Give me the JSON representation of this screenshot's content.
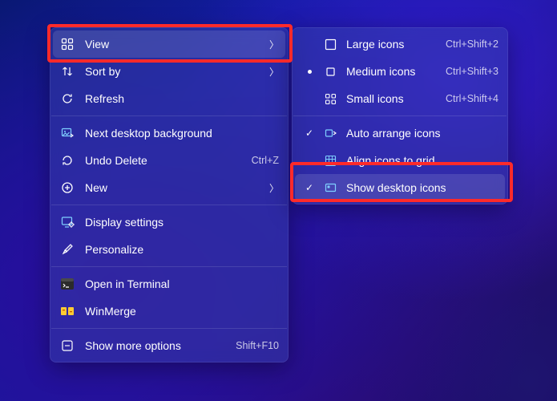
{
  "context_menu": {
    "groups": [
      [
        {
          "id": "view",
          "label": "View",
          "icon": "grid-icon",
          "shortcut": "",
          "submenu": true,
          "hover": true
        },
        {
          "id": "sortby",
          "label": "Sort by",
          "icon": "sort-icon",
          "shortcut": "",
          "submenu": true
        },
        {
          "id": "refresh",
          "label": "Refresh",
          "icon": "refresh-icon",
          "shortcut": ""
        }
      ],
      [
        {
          "id": "next-bg",
          "label": "Next desktop background",
          "icon": "picture-next-icon",
          "shortcut": ""
        },
        {
          "id": "undo",
          "label": "Undo Delete",
          "icon": "undo-icon",
          "shortcut": "Ctrl+Z"
        },
        {
          "id": "new",
          "label": "New",
          "icon": "plus-circle-icon",
          "shortcut": "",
          "submenu": true
        }
      ],
      [
        {
          "id": "display",
          "label": "Display settings",
          "icon": "display-gear-icon"
        },
        {
          "id": "perso",
          "label": "Personalize",
          "icon": "brush-icon"
        }
      ],
      [
        {
          "id": "terminal",
          "label": "Open in Terminal",
          "icon": "terminal-icon"
        },
        {
          "id": "winmerge",
          "label": "WinMerge",
          "icon": "winmerge-icon"
        }
      ],
      [
        {
          "id": "more",
          "label": "Show more options",
          "icon": "more-options-icon",
          "shortcut": "Shift+F10"
        }
      ]
    ]
  },
  "view_submenu": {
    "groups": [
      [
        {
          "id": "large",
          "label": "Large icons",
          "icon": "large-square-icon",
          "shortcut": "Ctrl+Shift+2",
          "radio": false
        },
        {
          "id": "medium",
          "label": "Medium icons",
          "icon": "medium-square-icon",
          "shortcut": "Ctrl+Shift+3",
          "radio": true
        },
        {
          "id": "small",
          "label": "Small icons",
          "icon": "small-grid-icon",
          "shortcut": "Ctrl+Shift+4",
          "radio": false
        }
      ],
      [
        {
          "id": "autoarrange",
          "label": "Auto arrange icons",
          "icon": "auto-arrange-icon",
          "checked": true
        },
        {
          "id": "align",
          "label": "Align icons to grid",
          "icon": "align-grid-icon",
          "checked": false
        },
        {
          "id": "showicons",
          "label": "Show desktop icons",
          "icon": "desktop-icons-icon",
          "checked": true,
          "hover": true
        }
      ]
    ]
  },
  "highlight_color": "#ff2a2a"
}
